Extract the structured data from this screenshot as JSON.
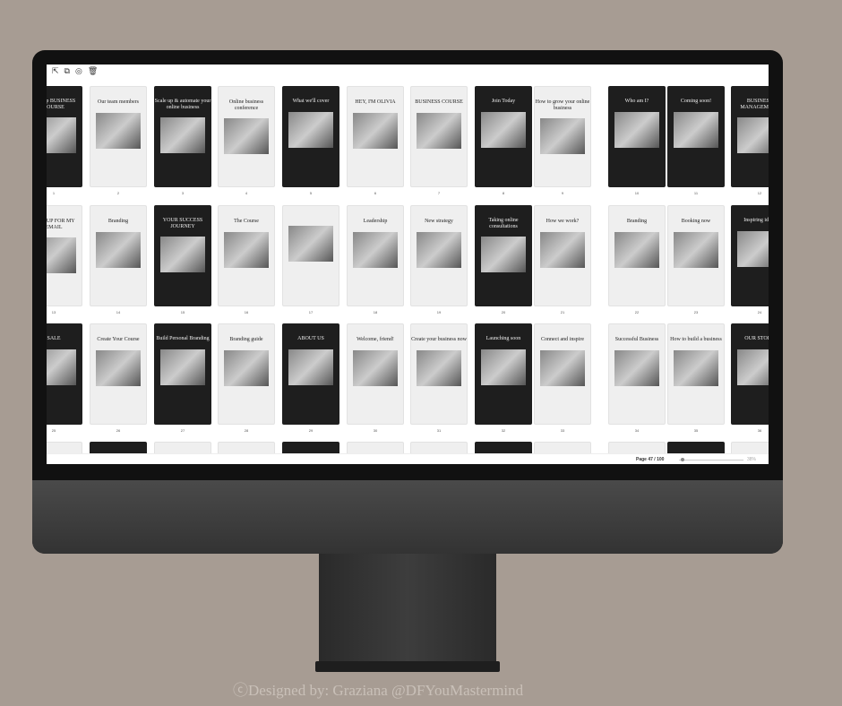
{
  "toolbar": {
    "icons": [
      "share-icon",
      "duplicate-icon",
      "hide-icon",
      "trash-icon"
    ]
  },
  "slides": [
    {
      "n": "1",
      "t": "Sign up BUSINESS COURSE",
      "d": 1
    },
    {
      "n": "2",
      "t": "Our team members",
      "d": 0
    },
    {
      "n": "3",
      "t": "Scale up & automate your online business",
      "d": 1
    },
    {
      "n": "4",
      "t": "Online business conference",
      "d": 0
    },
    {
      "n": "5",
      "t": "What we'll cover",
      "d": 1
    },
    {
      "n": "6",
      "t": "HEY, I'M OLIVIA",
      "d": 0
    },
    {
      "n": "7",
      "t": "BUSINESS COURSE",
      "d": 0
    },
    {
      "n": "8",
      "t": "Join Today",
      "d": 1
    },
    {
      "n": "9",
      "t": "How to grow your online business",
      "d": 0
    },
    {
      "n": "10",
      "t": "Who am I?",
      "d": 1
    },
    {
      "n": "11",
      "t": "Coming soon!",
      "d": 1
    },
    {
      "n": "12",
      "t": "BUSINESS MANAGEMENT",
      "d": 1
    },
    {
      "n": "13",
      "t": "SIGN UP FOR MY EMAIL",
      "d": 0
    },
    {
      "n": "14",
      "t": "Branding",
      "d": 0
    },
    {
      "n": "15",
      "t": "YOUR SUCCESS JOURNEY",
      "d": 1
    },
    {
      "n": "16",
      "t": "The Course",
      "d": 0
    },
    {
      "n": "17",
      "t": "",
      "d": 0
    },
    {
      "n": "18",
      "t": "Leadership",
      "d": 0
    },
    {
      "n": "19",
      "t": "New strategy",
      "d": 0
    },
    {
      "n": "20",
      "t": "Taking online consultations",
      "d": 1
    },
    {
      "n": "21",
      "t": "How we work?",
      "d": 0
    },
    {
      "n": "22",
      "t": "Branding",
      "d": 0
    },
    {
      "n": "23",
      "t": "Booking now",
      "d": 0
    },
    {
      "n": "24",
      "t": "Inspiring ideas",
      "d": 1
    },
    {
      "n": "25",
      "t": "SALE",
      "d": 1
    },
    {
      "n": "26",
      "t": "Create Your Course",
      "d": 0
    },
    {
      "n": "27",
      "t": "Build Personal Branding",
      "d": 1
    },
    {
      "n": "28",
      "t": "Branding guide",
      "d": 0
    },
    {
      "n": "29",
      "t": "ABOUT US",
      "d": 1
    },
    {
      "n": "30",
      "t": "Welcome, friend!",
      "d": 0
    },
    {
      "n": "31",
      "t": "Create your business now",
      "d": 0
    },
    {
      "n": "32",
      "t": "Launching soon",
      "d": 1
    },
    {
      "n": "33",
      "t": "Connect and inspire",
      "d": 0
    },
    {
      "n": "34",
      "t": "Successful Business",
      "d": 0
    },
    {
      "n": "35",
      "t": "How to build a business",
      "d": 0
    },
    {
      "n": "36",
      "t": "OUR STORY",
      "d": 1
    }
  ],
  "status": {
    "page": "Page 47 / 100",
    "zoom": "38%"
  },
  "credit": "ⓒDesigned by: Graziana @DFYouMastermind"
}
